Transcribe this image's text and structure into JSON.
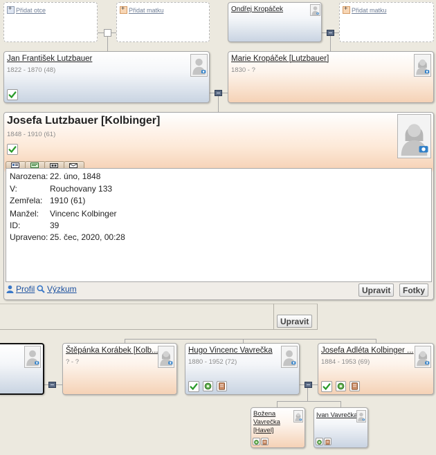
{
  "grandparents": {
    "add_father_label": "Přidat otce",
    "add_mother_label": "Přidat matku",
    "grandfather_name": "Ondřej Kropáček",
    "add_mother_right_label": "Přidat matku"
  },
  "parents": {
    "father": {
      "name": "Jan František Lutzbauer",
      "dates": "1822 - 1870 (48)"
    },
    "mother": {
      "name": "Marie Kropáček [Lutzbauer]",
      "dates": "1830 - ?"
    }
  },
  "focus": {
    "name": "Josefa Lutzbauer [Kolbinger]",
    "dates": "1848 - 1910 (61)",
    "tabs": [
      "overview-tab-icon",
      "facts-tab-icon",
      "family-tab-icon",
      "media-tab-icon"
    ],
    "details": {
      "born_label": "Narozena:",
      "born_value": "22. úno, 1848",
      "place_label": "V:",
      "place_value": "Rouchovany 133",
      "died_label": "Zemřela:",
      "died_value": "1910 (61)",
      "spouse_label": "Manžel:",
      "spouse_value": "Vincenc Kolbinger",
      "id_label": "ID:",
      "id_value": "39",
      "edited_label": "Upraveno:",
      "edited_value": "25. čec, 2020, 00:28"
    },
    "profile_link": "Profil",
    "research_link": "Výzkum",
    "edit_button": "Upravit",
    "photos_button": "Fotky"
  },
  "spouse_panel": {
    "edit_button": "Upravit"
  },
  "children": {
    "c1": {
      "name": "Štěpánka Korábek [Kolb...",
      "dates": "? - ?"
    },
    "c2": {
      "name": "Hugo Vincenc Vavrečka",
      "dates": "1880 - 1952 (72)"
    },
    "c3": {
      "name": "Josefa Adléta Kolbinger ...",
      "dates": "1884 - 1953 (69)"
    }
  },
  "grandchildren": {
    "g1": {
      "name_line1": "Božena",
      "name_line2": "Vavrečka",
      "name_line3": "[Havel]"
    },
    "g2": {
      "name": "Ivan Vavrečka"
    }
  },
  "colors": {
    "male_card": "#c9d4e2",
    "female_card": "#f5d2b6",
    "link": "#1a4f9e",
    "check": "#2a9b2a"
  }
}
